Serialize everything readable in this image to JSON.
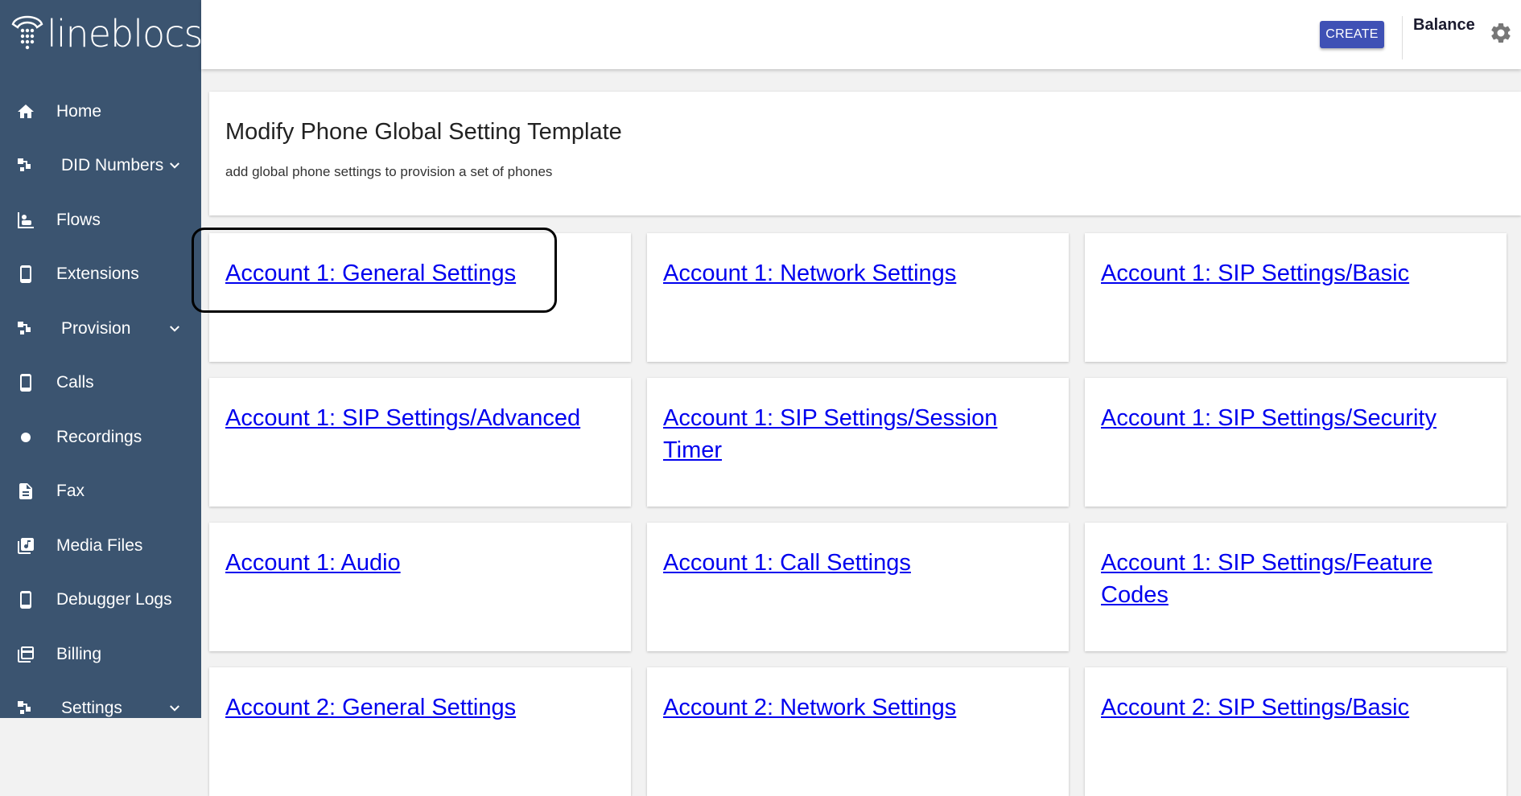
{
  "brand": {
    "name": "lineblocs"
  },
  "sidebar": {
    "items": [
      {
        "label": "Home",
        "icon": "home-icon",
        "caret": false,
        "indent": false
      },
      {
        "label": "DID Numbers",
        "icon": "did-numbers-icon",
        "caret": true,
        "indent": true
      },
      {
        "label": "Flows",
        "icon": "flows-icon",
        "caret": false,
        "indent": false
      },
      {
        "label": "Extensions",
        "icon": "phone-icon",
        "caret": false,
        "indent": false
      },
      {
        "label": "Provision",
        "icon": "provision-icon",
        "caret": true,
        "indent": true
      },
      {
        "label": "Calls",
        "icon": "phone-icon",
        "caret": false,
        "indent": false
      },
      {
        "label": "Recordings",
        "icon": "record-dot-icon",
        "caret": false,
        "indent": false
      },
      {
        "label": "Fax",
        "icon": "document-icon",
        "caret": false,
        "indent": false
      },
      {
        "label": "Media Files",
        "icon": "media-files-icon",
        "caret": false,
        "indent": false
      },
      {
        "label": "Debugger Logs",
        "icon": "phone-icon",
        "caret": false,
        "indent": false
      },
      {
        "label": "Billing",
        "icon": "billing-icon",
        "caret": false,
        "indent": false
      },
      {
        "label": "Settings",
        "icon": "settings-nav-icon",
        "caret": true,
        "indent": true
      }
    ]
  },
  "topbar": {
    "create_label": "CREATE",
    "balance_label": "Balance"
  },
  "header": {
    "title": "Modify Phone Global Setting Template",
    "subtitle": "add global phone settings to provision a set of phones"
  },
  "cards": [
    "Account 1: General Settings",
    "Account 1: Network Settings",
    "Account 1: SIP Settings/Basic",
    "Account 1: SIP Settings/Advanced",
    "Account 1: SIP Settings/Session Timer",
    "Account 1: SIP Settings/Security",
    "Account 1: Audio",
    "Account 1: Call Settings",
    "Account 1: SIP Settings/Feature Codes",
    "Account 2: General Settings",
    "Account 2: Network Settings",
    "Account 2: SIP Settings/Basic"
  ],
  "colors": {
    "sidebar_bg": "#3b5470",
    "primary": "#3f51b5",
    "link": "#0000ee"
  }
}
